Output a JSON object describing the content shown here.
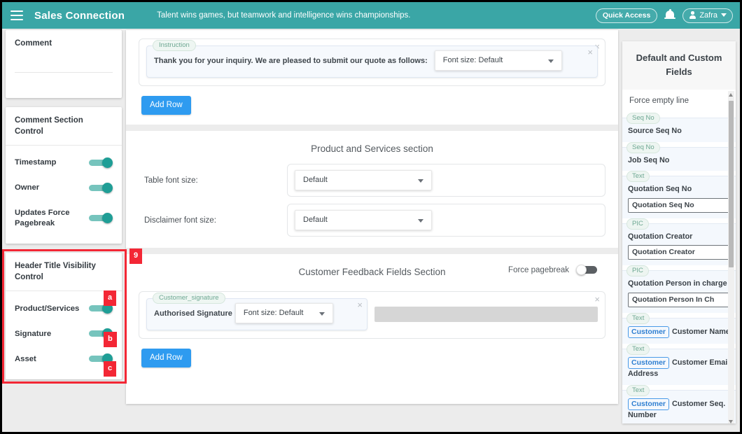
{
  "topnav": {
    "menu_icon": "hamburger-icon",
    "brand": "Sales Connection",
    "tagline": "Talent wins games, but teamwork and intelligence wins championships.",
    "quick_access": "Quick Access",
    "bell_icon": "bell-icon",
    "user": "Zafra",
    "accent_color": "#3aa6a6"
  },
  "sidebar": {
    "comment_card": {
      "title": "Comment"
    },
    "comment_section_control": {
      "title": "Comment Section Control",
      "toggles": [
        {
          "label": "Timestamp",
          "on": true
        },
        {
          "label": "Owner",
          "on": true
        },
        {
          "label": "Updates Force Pagebreak",
          "on": true
        }
      ]
    },
    "header_title_visibility_control": {
      "title": "Header Title Visibility Control",
      "toggles": [
        {
          "label": "Product/Services",
          "on": true,
          "annotation": "a"
        },
        {
          "label": "Signature",
          "on": true,
          "annotation": "b"
        },
        {
          "label": "Asset",
          "on": true,
          "annotation": "c"
        }
      ],
      "annotation": "9"
    },
    "annotation_color": "#f32735"
  },
  "main": {
    "instruction_section": {
      "row": {
        "legend": "Instruction",
        "text": "Thank you for your inquiry. We are pleased to submit our quote as follows:",
        "font_size_select": "Font size: Default",
        "close_inner": "×",
        "close_outer": "×"
      },
      "add_row_label": "Add Row"
    },
    "product_services_section": {
      "title": "Product and Services section",
      "settings": [
        {
          "label": "Table font size:",
          "value": "Default"
        },
        {
          "label": "Disclaimer font size:",
          "value": "Default"
        }
      ]
    },
    "customer_feedback_section": {
      "title": "Customer Feedback Fields Section",
      "force_pagebreak_label": "Force pagebreak",
      "force_pagebreak_on": false,
      "row": {
        "legend": "Customer_signature",
        "text": "Authorised Signature",
        "font_size_select": "Font size: Default",
        "close_inner": "×",
        "close_outer": "×"
      },
      "add_row_label": "Add Row"
    }
  },
  "right_panel": {
    "title": "Default and Custom Fields",
    "first_item": "Force empty line",
    "items": [
      {
        "tag": "Seq No",
        "label": "Source Seq No",
        "chip": "",
        "input": ""
      },
      {
        "tag": "Seq No",
        "label": "Job Seq No",
        "chip": "",
        "input": ""
      },
      {
        "tag": "Text",
        "label": "Quotation Seq No",
        "chip": "",
        "input": "Quotation Seq No"
      },
      {
        "tag": "PIC",
        "label": "Quotation Creator",
        "chip": "",
        "input": "Quotation Creator"
      },
      {
        "tag": "PIC",
        "label": "Quotation Person in charge",
        "chip": "",
        "input": "Quotation Person In Ch"
      },
      {
        "tag": "Text",
        "label": "Customer Name",
        "chip": "Customer",
        "input": ""
      },
      {
        "tag": "Text",
        "label": "Customer Email Address",
        "chip": "Customer",
        "input": ""
      },
      {
        "tag": "Text",
        "label": "Customer Seq. Number",
        "chip": "Customer",
        "input": ""
      }
    ]
  }
}
